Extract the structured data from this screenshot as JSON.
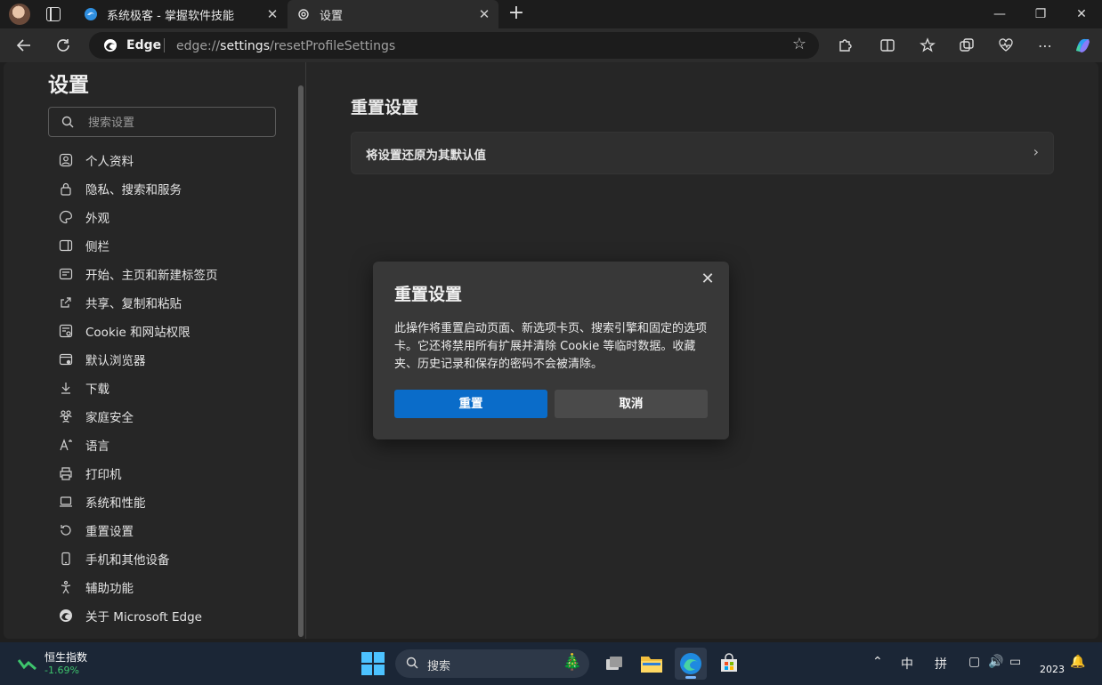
{
  "titlebar": {
    "tabs": [
      {
        "label": "系统极客 - 掌握软件技能",
        "icon": "edge-favicon"
      },
      {
        "label": "设置",
        "icon": "gear-icon"
      }
    ],
    "new_tab": "+",
    "window_controls": {
      "minimize": "—",
      "maximize": "❐",
      "close": "✕"
    }
  },
  "toolbar": {
    "brand": "Edge",
    "url_prefix": "edge://",
    "url_host": "settings",
    "url_path": "/resetProfileSettings"
  },
  "sidebar": {
    "title": "设置",
    "search_placeholder": "搜索设置",
    "items": [
      {
        "label": "个人资料",
        "icon": "profile-icon"
      },
      {
        "label": "隐私、搜索和服务",
        "icon": "lock-icon"
      },
      {
        "label": "外观",
        "icon": "palette-icon"
      },
      {
        "label": "侧栏",
        "icon": "sidebar-icon"
      },
      {
        "label": "开始、主页和新建标签页",
        "icon": "home-icon"
      },
      {
        "label": "共享、复制和粘贴",
        "icon": "share-icon"
      },
      {
        "label": "Cookie 和网站权限",
        "icon": "cookie-icon"
      },
      {
        "label": "默认浏览器",
        "icon": "browser-icon"
      },
      {
        "label": "下载",
        "icon": "download-icon"
      },
      {
        "label": "家庭安全",
        "icon": "family-icon"
      },
      {
        "label": "语言",
        "icon": "language-icon"
      },
      {
        "label": "打印机",
        "icon": "printer-icon"
      },
      {
        "label": "系统和性能",
        "icon": "laptop-icon"
      },
      {
        "label": "重置设置",
        "icon": "reset-icon"
      },
      {
        "label": "手机和其他设备",
        "icon": "phone-icon"
      },
      {
        "label": "辅助功能",
        "icon": "accessibility-icon"
      },
      {
        "label": "关于 Microsoft Edge",
        "icon": "edge-icon"
      }
    ]
  },
  "main": {
    "title": "重置设置",
    "card_label": "将设置还原为其默认值"
  },
  "dialog": {
    "title": "重置设置",
    "body": "此操作将重置启动页面、新选项卡页、搜索引擎和固定的选项卡。它还将禁用所有扩展并清除 Cookie 等临时数据。收藏夹、历史记录和保存的密码不会被清除。",
    "confirm_label": "重置",
    "cancel_label": "取消",
    "close": "✕"
  },
  "taskbar": {
    "stock_name": "恒生指数",
    "stock_change": "-1.69%",
    "search_label": "搜索",
    "ime_mode": "中",
    "ime_type": "拼",
    "clock_year": "2023"
  }
}
